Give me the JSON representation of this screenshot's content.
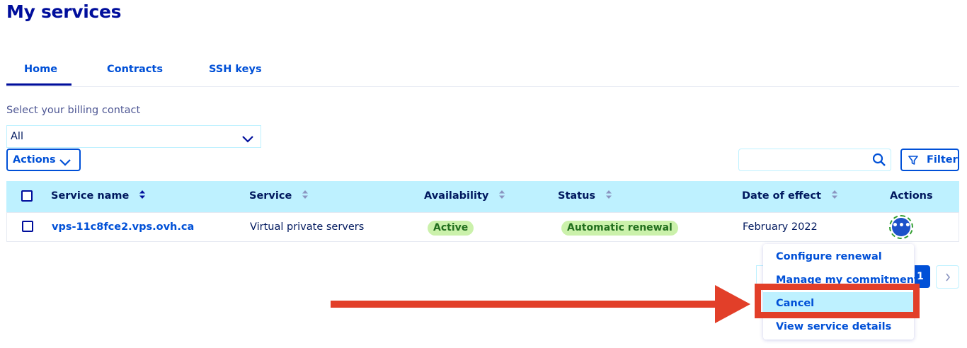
{
  "page": {
    "title": "My services"
  },
  "tabs": [
    {
      "label": "Home",
      "active": true
    },
    {
      "label": "Contracts"
    },
    {
      "label": "SSH keys"
    }
  ],
  "billing": {
    "label": "Select your billing contact",
    "selected": "All"
  },
  "toolbar": {
    "actions_label": "Actions",
    "search_placeholder": "",
    "filter_label": "Filter"
  },
  "table": {
    "columns": [
      "Service name",
      "Service",
      "Availability",
      "Status",
      "Date of effect",
      "Actions"
    ],
    "rows": [
      {
        "service_name": "vps-11c8fce2.vps.ovh.ca",
        "service": "Virtual private servers",
        "availability": "Active",
        "status": "Automatic renewal",
        "date_of_effect": "February 2022",
        "more_glyph": "•••"
      }
    ]
  },
  "actions_menu": {
    "items": [
      "Configure renewal",
      "Manage my commitment",
      "Cancel",
      "View service details"
    ],
    "highlighted": "Cancel"
  },
  "pagination": {
    "current_page": "1"
  },
  "annotation": {
    "color": "#e23f29",
    "points_to": "Cancel"
  },
  "colors": {
    "brand": "#000e9c",
    "link": "#0050d7",
    "header_bg": "#bef1ff",
    "badge_bg": "#cbf1ab",
    "badge_text": "#226f1e"
  }
}
